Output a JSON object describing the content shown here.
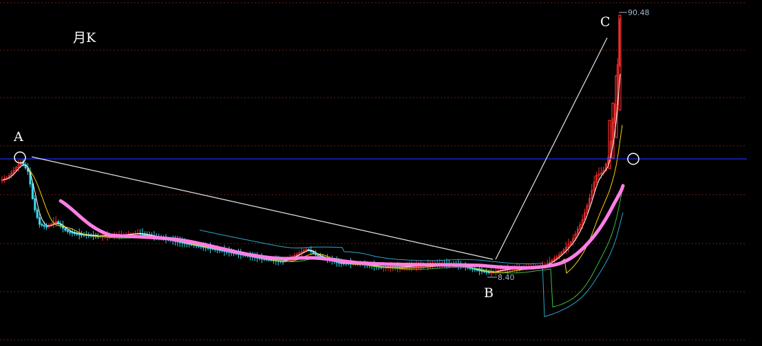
{
  "chart_data": {
    "type": "candlestick",
    "title": "月K",
    "points": [
      {
        "label": "A"
      },
      {
        "label": "B",
        "price": "8.40"
      },
      {
        "label": "C",
        "price": "90.48"
      }
    ],
    "price_high": 90.48,
    "price_low": 8.4,
    "grid": true,
    "colors": {
      "background": "#000000",
      "grid": "#7a1a1a",
      "up": "#ff3030",
      "down": "#3ad6e8",
      "ma_pink": "#ff7ee6",
      "ma_white": "#ffffff",
      "ma_yellow": "#ffd400",
      "ma_green": "#3ec13e",
      "ma_cyan": "#2aa9c9",
      "horizontal_line": "#1f2dff",
      "trend_line": "#e8e8e8",
      "marker_circle": "#ffffff"
    }
  }
}
